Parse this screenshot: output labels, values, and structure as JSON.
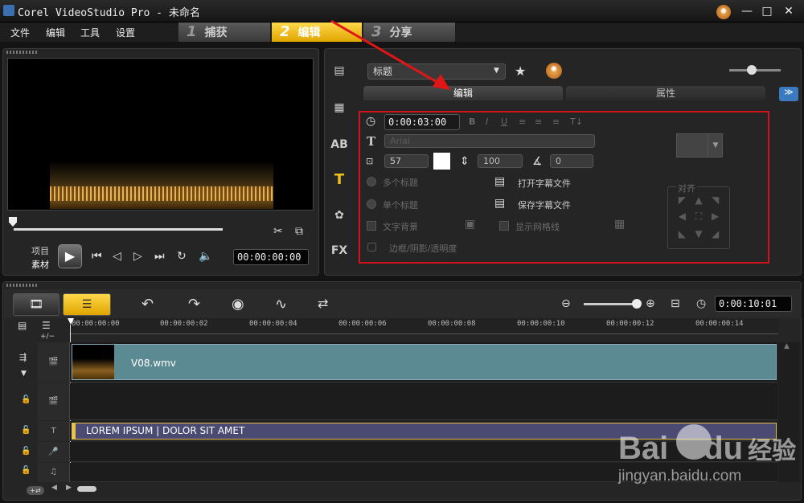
{
  "window": {
    "title": "Corel VideoStudio Pro - 未命名",
    "minimize": "—",
    "maximize": "□",
    "close": "✕"
  },
  "menu": [
    "文件",
    "编辑",
    "工具",
    "设置"
  ],
  "steps": [
    {
      "num": "1",
      "label": "捕获"
    },
    {
      "num": "2",
      "label": "编辑"
    },
    {
      "num": "3",
      "label": "分享"
    }
  ],
  "player": {
    "mode_project": "项目",
    "mode_clip": "素材",
    "timecode": "00:00:00:00"
  },
  "options": {
    "category": "标题",
    "tab_edit": "编辑",
    "tab_properties": "属性",
    "duration": "0:00:03:00",
    "font": "Arial",
    "font_size": "57",
    "line_spacing": "100",
    "angle": "0",
    "multi_title": "多个标题",
    "single_title": "单个标题",
    "text_background": "文字背景",
    "show_grid": "显示网格线",
    "border_shadow": "边框/阴影/透明度",
    "open_subtitle": "打开字幕文件",
    "save_subtitle": "保存字幕文件",
    "align": "对齐"
  },
  "timeline": {
    "total_time": "0:00:10:01",
    "ruler_labels": [
      "00:00:00:00",
      "00:00:00:02",
      "00:00:00:04",
      "00:00:00:06",
      "00:00:00:08",
      "00:00:00:10",
      "00:00:00:12",
      "00:00:00:14"
    ],
    "video_clip_name": "V08.wmv",
    "title_clip_text": "LOREM IPSUM | DOLOR SIT AMET",
    "track_toggle": "+/−",
    "add_track": "+⇄"
  },
  "watermark": {
    "brand": "Bai",
    "brand2": "du",
    "suffix": "经验",
    "url": "jingyan.baidu.com"
  },
  "colors": {
    "active_step": "#f0c020",
    "red_annotation": "#e01515",
    "video_clip": "#5b8a93",
    "title_clip": "#4a4a72"
  }
}
